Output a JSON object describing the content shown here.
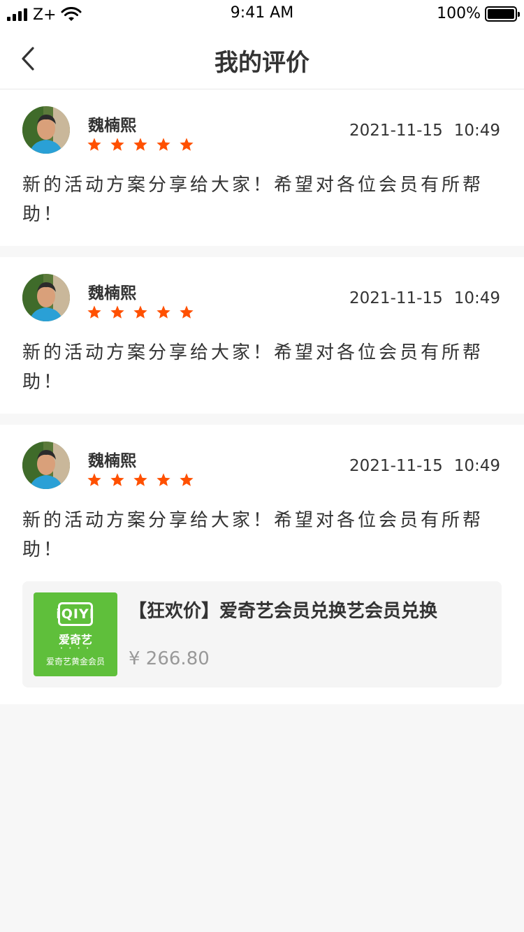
{
  "status_bar": {
    "carrier": "Z+",
    "time": "9:41 AM",
    "battery": "100%"
  },
  "nav": {
    "title": "我的评价",
    "back_icon": "chevron-left-icon"
  },
  "colors": {
    "star": "#ff5000",
    "product_bg": "#5fbf3b",
    "price": "#999999"
  },
  "reviews": [
    {
      "username": "魏楠熙",
      "rating": 5,
      "date": "2021-11-15",
      "time": "10:49",
      "content": "新的活动方案分享给大家！希望对各位会员有所帮助！"
    },
    {
      "username": "魏楠熙",
      "rating": 5,
      "date": "2021-11-15",
      "time": "10:49",
      "content": "新的活动方案分享给大家！希望对各位会员有所帮助！"
    },
    {
      "username": "魏楠熙",
      "rating": 5,
      "date": "2021-11-15",
      "time": "10:49",
      "content": "新的活动方案分享给大家！希望对各位会员有所帮助！",
      "product": {
        "title": "【狂欢价】爱奇艺会员兑换艺会员兑换",
        "price": "¥ 266.80",
        "logo_text": "iQIYI",
        "brand": "爱奇艺",
        "caption": "爱奇艺黄金会员"
      }
    }
  ]
}
